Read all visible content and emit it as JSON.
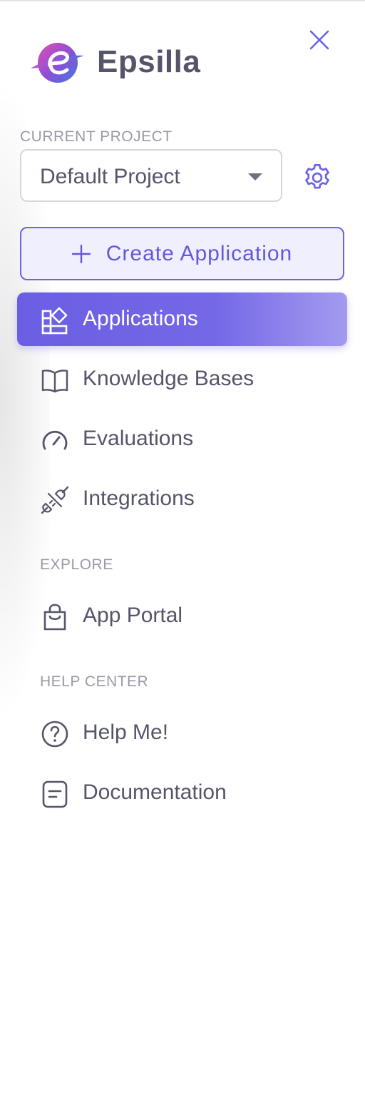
{
  "brand": {
    "name": "Epsilla",
    "logo_icon": "epsilla-logo"
  },
  "close_icon": "close-icon",
  "project": {
    "section_label": "CURRENT PROJECT",
    "selected": "Default Project",
    "settings_icon": "gear-icon"
  },
  "create_button": {
    "label": "Create Application",
    "icon": "plus-icon"
  },
  "nav": {
    "items": [
      {
        "label": "Applications",
        "icon": "apps-icon",
        "active": true
      },
      {
        "label": "Knowledge Bases",
        "icon": "book-icon",
        "active": false
      },
      {
        "label": "Evaluations",
        "icon": "gauge-icon",
        "active": false
      },
      {
        "label": "Integrations",
        "icon": "plug-icon",
        "active": false
      }
    ]
  },
  "explore": {
    "section_label": "EXPLORE",
    "items": [
      {
        "label": "App Portal",
        "icon": "shopping-bag-icon"
      }
    ]
  },
  "help": {
    "section_label": "HELP CENTER",
    "items": [
      {
        "label": "Help Me!",
        "icon": "question-circle-icon"
      },
      {
        "label": "Documentation",
        "icon": "document-icon"
      }
    ]
  },
  "colors": {
    "accent": "#6c63e6",
    "accent_light": "#f0effd",
    "text": "#55556a",
    "muted": "#9a9aa8"
  }
}
